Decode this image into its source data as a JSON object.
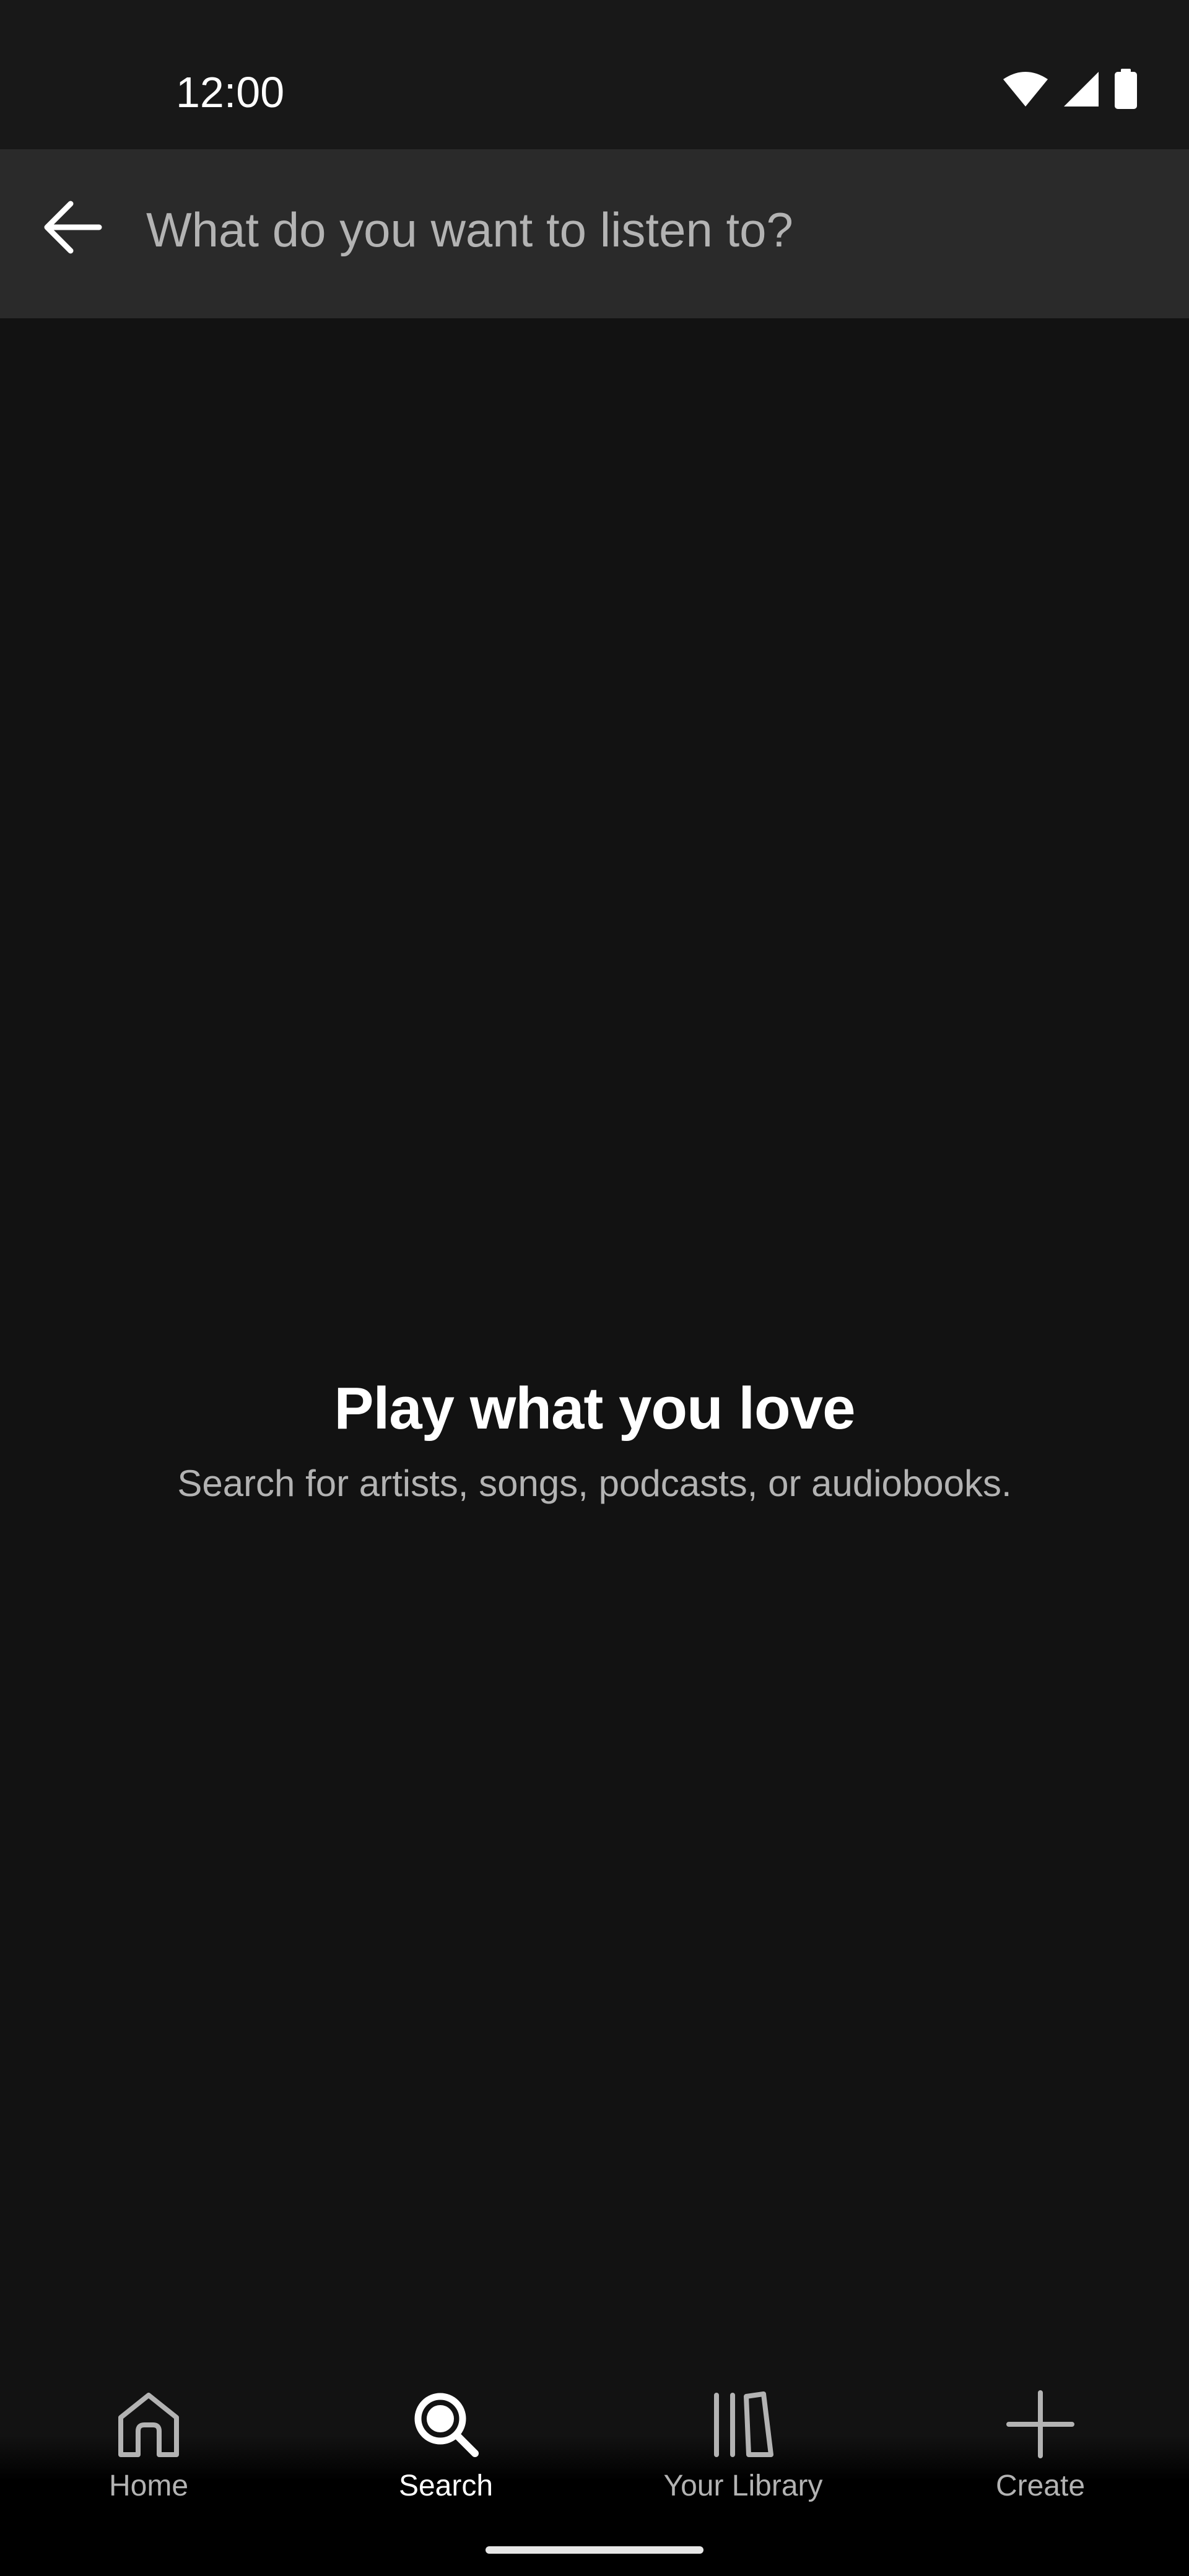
{
  "status_bar": {
    "time": "12:00",
    "icons": [
      "wifi-icon",
      "cellular-signal-icon",
      "battery-icon"
    ]
  },
  "search": {
    "back_icon": "arrow-left-icon",
    "placeholder": "What do you want to listen to?",
    "value": ""
  },
  "empty_state": {
    "title": "Play what you love",
    "subtitle": "Search for artists, songs, podcasts, or audiobooks."
  },
  "bottom_nav": {
    "items": [
      {
        "label": "Home",
        "icon": "home-icon",
        "active": false
      },
      {
        "label": "Search",
        "icon": "search-icon",
        "active": true
      },
      {
        "label": "Your Library",
        "icon": "library-icon",
        "active": false
      },
      {
        "label": "Create",
        "icon": "plus-icon",
        "active": false
      }
    ]
  },
  "colors": {
    "background": "#121212",
    "header": "#2a2a2a",
    "text_primary": "#ffffff",
    "text_secondary": "#b3b3b3"
  }
}
